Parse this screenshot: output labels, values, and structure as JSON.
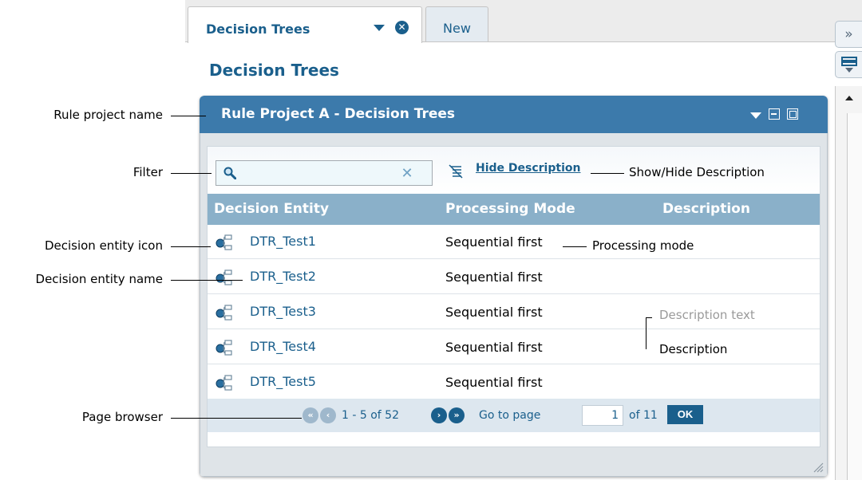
{
  "tabs": [
    {
      "label": "Decision Trees"
    },
    {
      "label": "New"
    }
  ],
  "page": {
    "title": "Decision Trees"
  },
  "portlet": {
    "title": "Rule Project A - Decision Trees",
    "filter": {
      "value": "",
      "placeholder": ""
    },
    "hide_description_label": "Hide Description",
    "columns": [
      "Decision Entity",
      "Processing Mode",
      "Description"
    ],
    "rows": [
      {
        "name": "DTR_Test1",
        "mode": "Sequential first"
      },
      {
        "name": "DTR_Test2",
        "mode": "Sequential first"
      },
      {
        "name": "DTR_Test3",
        "mode": "Sequential first"
      },
      {
        "name": "DTR_Test4",
        "mode": "Sequential first"
      },
      {
        "name": "DTR_Test5",
        "mode": "Sequential first"
      }
    ],
    "pager": {
      "range": "1 - 5 of 52",
      "go_to_label": "Go to page",
      "page_value": "1",
      "of_pages": "of 11",
      "ok_label": "OK"
    }
  },
  "annotations": {
    "rule_project_name": "Rule project name",
    "filter": "Filter",
    "decision_entity_icon": "Decision entity icon",
    "decision_entity_name": "Decision entity name",
    "page_browser": "Page browser",
    "show_hide_description": "Show/Hide Description",
    "processing_mode": "Processing mode",
    "description_text": "Description text",
    "description": "Description"
  },
  "colors": {
    "accent": "#1a5f8c",
    "header": "#3c7aab",
    "table_header": "#8ab0c9"
  }
}
